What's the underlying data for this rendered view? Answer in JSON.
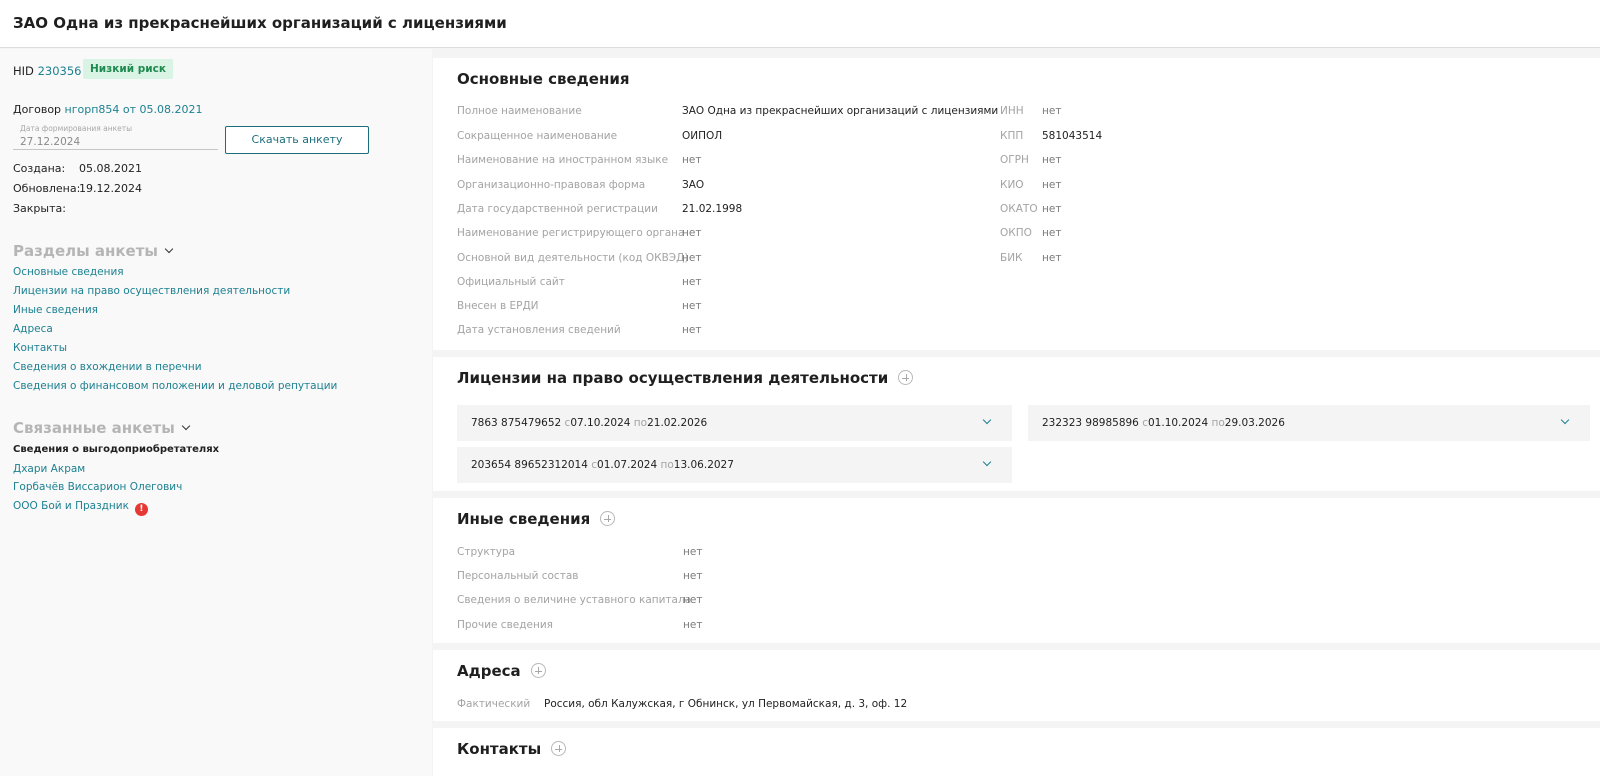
{
  "header": {
    "title": "ЗАО Одна из прекраснейших организаций с лицензиями"
  },
  "sidebar": {
    "hid_label": "HID",
    "hid_value": "230356",
    "risk_badge": "Низкий риск",
    "contract_label": "Договор",
    "contract_link": "нгорп854 от 05.08.2021",
    "date_field_label": "Дата формирования анкеты",
    "date_field_value": "27.12.2024",
    "download_button": "Скачать анкету",
    "meta": {
      "created_label": "Создана:",
      "created_value": "05.08.2021",
      "updated_label": "Обновлена:",
      "updated_value": "19.12.2024",
      "closed_label": "Закрыта:"
    },
    "sections_title": "Разделы анкеты",
    "sections": [
      "Основные сведения",
      "Лицензии на право осуществления деятельности",
      "Иные сведения",
      "Адреса",
      "Контакты",
      "Сведения о вхождении в перечни",
      "Сведения о финансовом положении и деловой репутации"
    ],
    "related_title": "Связанные анкеты",
    "related_heading": "Сведения о выгодоприобретателях",
    "related": [
      "Дхари Акрам",
      "Горбачёв Виссарион Олегович",
      "ООО Бой и Праздник"
    ],
    "alert_mark": "!"
  },
  "main_info": {
    "title": "Основные сведения",
    "rows": [
      {
        "label": "Полное наименование",
        "value": "ЗАО Одна из прекраснейших организаций с лицензиями"
      },
      {
        "label": "Сокращенное наименование",
        "value": "ОИПОЛ"
      },
      {
        "label": "Наименование на иностранном языке",
        "value": "нет"
      },
      {
        "label": "Организационно-правовая форма",
        "value": "ЗАО"
      },
      {
        "label": "Дата государственной регистрации",
        "value": "21.02.1998"
      },
      {
        "label": "Наименование регистрирующего органа",
        "value": "нет"
      },
      {
        "label": "Основной вид деятельности (код ОКВЭД)",
        "value": "нет"
      },
      {
        "label": "Официальный сайт",
        "value": "нет"
      },
      {
        "label": "Внесен в ЕРДИ",
        "value": "нет"
      },
      {
        "label": "Дата установления сведений",
        "value": "нет"
      }
    ],
    "codes": [
      {
        "label": "ИНН",
        "value": "нет"
      },
      {
        "label": "КПП",
        "value": "581043514"
      },
      {
        "label": "ОГРН",
        "value": "нет"
      },
      {
        "label": "КИО",
        "value": "нет"
      },
      {
        "label": "ОКАТО",
        "value": "нет"
      },
      {
        "label": "ОКПО",
        "value": "нет"
      },
      {
        "label": "БИК",
        "value": "нет"
      }
    ]
  },
  "licenses": {
    "title": "Лицензии на право осуществления деятельности",
    "from_label": "с",
    "to_label": "по",
    "items": [
      {
        "number": "7863 875479652",
        "from": "07.10.2024",
        "to": "21.02.2026"
      },
      {
        "number": "232323 98985896",
        "from": "01.10.2024",
        "to": "29.03.2026"
      },
      {
        "number": "203654 89652312014",
        "from": "01.07.2024",
        "to": "13.06.2027"
      }
    ]
  },
  "other_info": {
    "title": "Иные сведения",
    "rows": [
      {
        "label": "Структура",
        "value": "нет"
      },
      {
        "label": "Персональный состав",
        "value": "нет"
      },
      {
        "label": "Сведения о величине уставного капитала",
        "value": "нет"
      },
      {
        "label": "Прочие сведения",
        "value": "нет"
      }
    ]
  },
  "addresses": {
    "title": "Адреса",
    "rows": [
      {
        "label": "Фактический",
        "value": "Россия, обл Калужская, г Обнинск, ул Первомайская, д. 3, оф. 12"
      }
    ]
  },
  "contacts": {
    "title": "Контакты"
  }
}
